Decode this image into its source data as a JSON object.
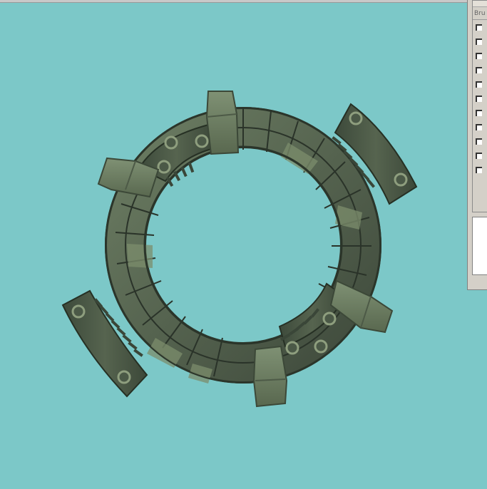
{
  "side_panel": {
    "header_label": "Bru",
    "checkbox_count": 11
  },
  "colors": {
    "background": "#7cc8c8",
    "stone_dark": "#4a5646",
    "stone_light": "#7d8e6f",
    "bracket": "#6e7e64",
    "rim_dark": "#2e3a30"
  }
}
